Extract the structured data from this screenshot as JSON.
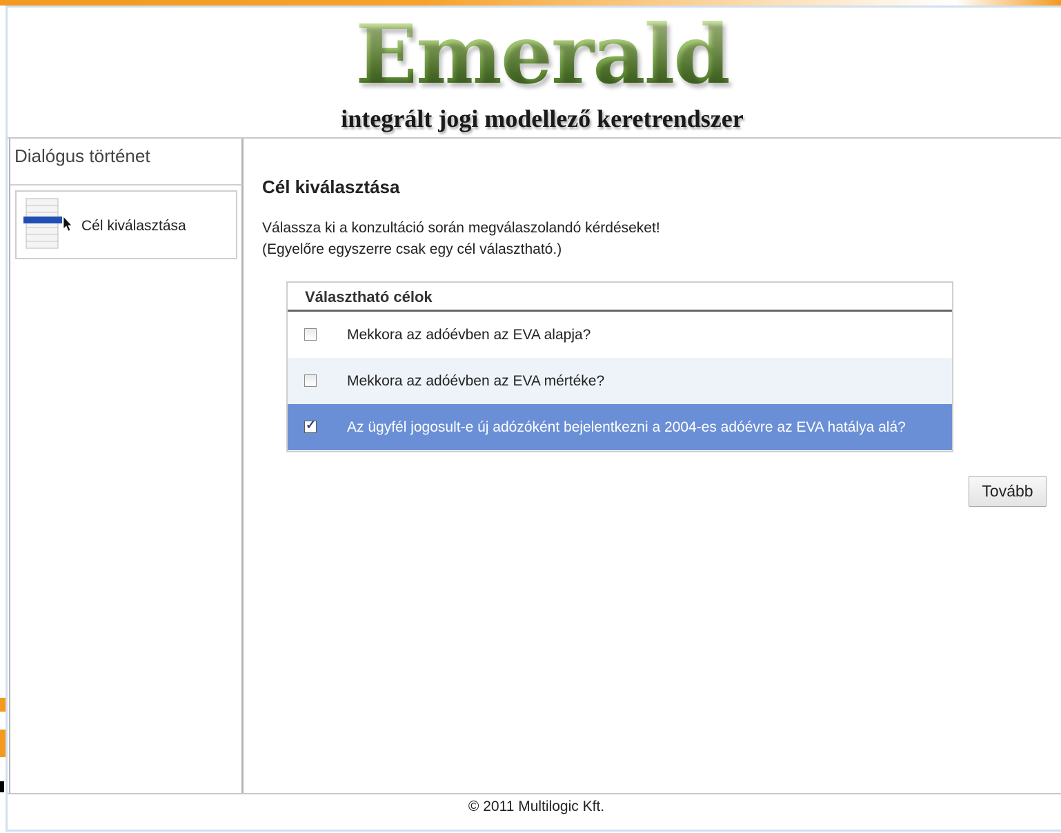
{
  "header": {
    "logo_word": "Emerald",
    "logo_subtitle": "integrált jogi modellező keretrendszer"
  },
  "sidebar": {
    "title": "Dialógus történet",
    "items": [
      {
        "label": "Cél kiválasztása",
        "icon": "goal-selection-list-icon"
      }
    ]
  },
  "main": {
    "title": "Cél kiválasztása",
    "instruction_line1": "Válassza ki a konzultáció során megválaszolandó kérdéseket!",
    "instruction_line2": "(Egyelőre egyszerre csak egy cél választható.)",
    "goals": {
      "header": "Választható célok",
      "rows": [
        {
          "text": "Mekkora az adóévben az EVA alapja?",
          "checked": false
        },
        {
          "text": "Mekkora az adóévben az EVA mértéke?",
          "checked": false
        },
        {
          "text": "Az ügyfél jogosult-e új adózóként bejelentkezni a 2004-es adóévre az EVA hatálya alá?",
          "checked": true
        }
      ]
    },
    "next_button": "Tovább"
  },
  "footer": {
    "copyright": "© 2011 Multilogic Kft."
  },
  "colors": {
    "selected_row": "#6a8fd6",
    "alt_row": "#eef3fa",
    "frame_accent": "#f39a1f"
  }
}
